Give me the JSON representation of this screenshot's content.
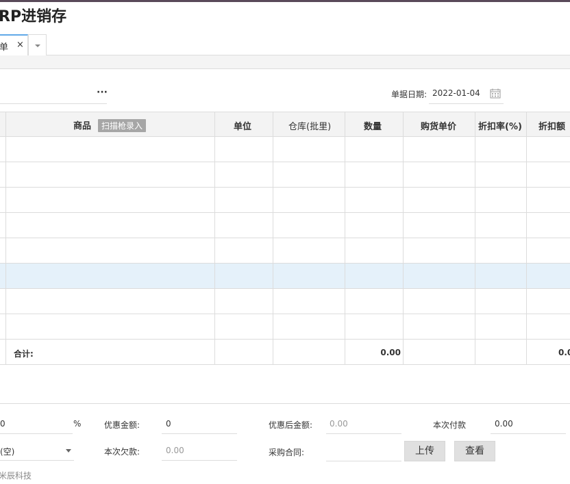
{
  "app": {
    "title": "RP进销存"
  },
  "tabs": [
    {
      "label": "单",
      "close": "×"
    }
  ],
  "form": {
    "supplier_more": "···",
    "date_label": "单据日期:",
    "date_value": "2022-01-04"
  },
  "grid": {
    "headers": [
      "商品",
      "单位",
      "仓库(批里)",
      "数量",
      "购货单价",
      "折扣率(%)",
      "折扣额"
    ],
    "scan_label": "扫描枪录入",
    "row_count": 8,
    "selected_row": 5,
    "total_label": "合计:",
    "total_qty": "0.00",
    "total_discount": "0.0"
  },
  "bottom": {
    "discount_rate_value": "0",
    "discount_rate_unit": "%",
    "discount_amount_label": "优惠金额:",
    "discount_amount_value": "0",
    "after_discount_label": "优惠后金额:",
    "after_discount_placeholder": "0.00",
    "payment_label": "本次付款",
    "payment_value": "0.00",
    "account_value": "(空)",
    "debt_label": "本次欠款:",
    "debt_placeholder": "0.00",
    "contract_label": "采购合同:",
    "upload_label": "上传",
    "view_label": "查看"
  },
  "footer": {
    "text": "米辰科技"
  },
  "colors": {
    "accent": "#5fa8e8",
    "selected_row": "#e5f1fa",
    "header_bg": "#f3f3f3",
    "button_bg": "#e0e0e0"
  }
}
